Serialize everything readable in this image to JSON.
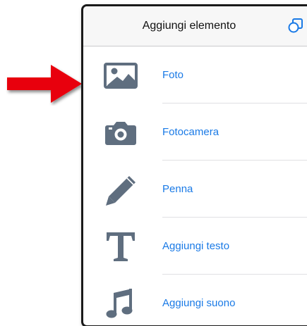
{
  "header": {
    "title": "Aggiungi elemento"
  },
  "items": [
    {
      "label": "Foto",
      "icon": "photo-icon"
    },
    {
      "label": "Fotocamera",
      "icon": "camera-icon"
    },
    {
      "label": "Penna",
      "icon": "pencil-icon"
    },
    {
      "label": "Aggiungi testo",
      "icon": "text-icon"
    },
    {
      "label": "Aggiungi suono",
      "icon": "music-note-icon"
    }
  ],
  "colors": {
    "accent": "#1a7ae6",
    "icon": "#5f6e7f",
    "arrow": "#e8000b"
  }
}
